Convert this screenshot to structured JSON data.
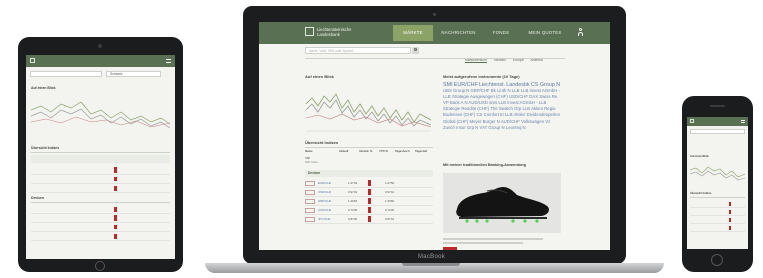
{
  "laptop": {
    "brand_label": "MacBook",
    "site": {
      "logo_line1": "Liechtensteinische",
      "logo_line2": "Landesbank",
      "nav": [
        {
          "label": "MÄRKTE",
          "active": true
        },
        {
          "label": "NACHRICHTEN",
          "active": false
        },
        {
          "label": "FONDS",
          "active": false
        },
        {
          "label": "MEIN QUOTES",
          "active": false
        }
      ],
      "search_placeholder": "Name, Valor, ISIN oder Symbol",
      "tabs": [
        {
          "label": "Marktübersicht",
          "active": true
        },
        {
          "label": "Schweiz",
          "active": false
        },
        {
          "label": "Europa",
          "active": false
        },
        {
          "label": "Amerika",
          "active": false
        }
      ],
      "chart_title": "Auf einen Blick",
      "most_searched_title": "Meist aufgerufene Instrumente (10 Tage)",
      "cloud_words": [
        {
          "text": "SMI",
          "big": true
        },
        {
          "text": "EUR/CHF",
          "big": true
        },
        {
          "text": "Liechtenst.",
          "big": true
        },
        {
          "text": "Landesbk",
          "big": true
        },
        {
          "text": "CS Group N",
          "big": true
        },
        {
          "text": "UBS Group N",
          "big": false
        },
        {
          "text": "GBP/CHF",
          "big": false
        },
        {
          "text": "Bk Linth N",
          "big": false
        },
        {
          "text": "LLB",
          "big": false
        },
        {
          "text": "LLB Invest",
          "big": false
        },
        {
          "text": "AGmbH - LLB Strategie Ausgewogen (CHF)",
          "big": false
        },
        {
          "text": "USD/CHF",
          "big": false
        },
        {
          "text": "DAX",
          "big": false
        },
        {
          "text": "Swiss Re",
          "big": false
        },
        {
          "text": "VP Bank A",
          "big": false
        },
        {
          "text": "N",
          "big": false
        },
        {
          "text": "AUD/USD",
          "big": false
        },
        {
          "text": "ams",
          "big": false
        },
        {
          "text": "LLB Invest AGmbH - LLB Strategie Rendite (CHF)",
          "big": false
        },
        {
          "text": "The Swatch Grp",
          "big": false
        },
        {
          "text": "LLB Aktien Regio Bodensee (CHF)",
          "big": false
        },
        {
          "text": "CS",
          "big": false
        },
        {
          "text": "Comfort III",
          "big": false
        },
        {
          "text": "LLB Aktien Dividendenperlen Global (CHF)",
          "big": false
        },
        {
          "text": "Meyer Burger N",
          "big": false
        },
        {
          "text": "AUD/CHF",
          "big": false
        },
        {
          "text": "Volkswagen Vz",
          "big": false
        },
        {
          "text": "Zurich Insur Grp N",
          "big": false
        },
        {
          "text": "VAT Group N",
          "big": false
        },
        {
          "text": "Leonteq N",
          "big": false
        }
      ],
      "overview_title": "Übersicht Indizes",
      "overview_headers": [
        "Name",
        "Aktuell",
        "Veränd. %",
        "YTD %",
        "Tageshoch",
        "Tagestief"
      ],
      "overview_row": {
        "name": "SMI",
        "sub": "SMI Index"
      },
      "promo_title": "Mit meiner traditionellen Banking-Anwendung",
      "promo_image": "shoe-with-green-cleats",
      "promo_button_label": "",
      "currencies_title": "Devisen",
      "currency_rows": [
        {
          "name": "EUR/CHF",
          "v1": "1.0743",
          "v2": "1.0750"
        },
        {
          "name": "USD/CHF",
          "v1": "0.9734",
          "v2": "0.9741"
        },
        {
          "name": "GBP/CHF",
          "v1": "1.2652",
          "v2": "1.2660"
        },
        {
          "name": "AUD/CHF",
          "v1": "0.7236",
          "v2": "0.7240"
        },
        {
          "name": "JPY/CHF",
          "v1": "0.8730",
          "v2": "0.8741"
        }
      ]
    }
  },
  "tablet": {
    "select_label": "Schweiz",
    "chart_title": "Auf einen Blick",
    "overview_title": "Übersicht Indizes",
    "currencies_title": "Devisen"
  },
  "phone": {
    "chart_title": "Auf einen Blick",
    "overview_title": "Übersicht Indizes"
  },
  "colors": {
    "brand_green": "#5a7053",
    "active_green": "#8ca368",
    "accent_red": "#b52a2a",
    "link_blue": "#6b85ad"
  }
}
